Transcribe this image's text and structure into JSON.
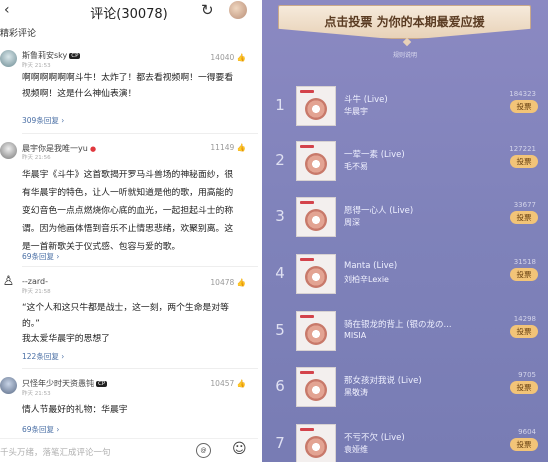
{
  "left": {
    "back_glyph": "‹",
    "title": "评论(30078)",
    "refresh_glyph": "↻",
    "section_title": "精彩评论",
    "comments": [
      {
        "name": "斯鲁莉安sky",
        "badge": "CP",
        "time": "昨天 21:53",
        "likes": "14040",
        "lines": [
          "啊啊啊啊啊啊斗牛！太炸了！都去看视频啊！一得要看",
          "视频啊！这是什么神仙表演！"
        ],
        "replies": "309条回复 ›"
      },
      {
        "name": "晨宇你是我唯一yu",
        "badge": "",
        "time": "昨天 21:56",
        "likes": "11149",
        "lines": [
          "华晨宇《斗牛》这首歌揭开罗马斗兽场的神秘面纱，很",
          "有华晨宇的特色，让人一听就知道是他的歌，用高能的",
          "变幻音色一点点燃烧你心底的血光，一起担起斗士的称",
          "谓。因为他画体悟到音乐不止情思悲绪，欢聚别离。这",
          "是一首新歌关于仪式感、包容与爱的歌。"
        ],
        "replies": "69条回复 ›"
      },
      {
        "name": "--zard-",
        "badge": "",
        "time": "昨天 21:58",
        "likes": "10478",
        "lines": [
          "“这个人和这只牛都是战士，这一刻，两个生命是对等",
          "的。”",
          "我太爱华晨宇的思想了"
        ],
        "replies": "122条回复 ›"
      },
      {
        "name": "只怪年少时天资愚钝",
        "badge": "CP",
        "time": "昨天 21:53",
        "likes": "10457",
        "lines": [
          "情人节最好的礼物：华晨宇"
        ],
        "replies": "69条回复 ›"
      }
    ],
    "input_placeholder": "千头万绪，落笔汇成评论一句",
    "emoji_glyph": "☺",
    "at_label": "@"
  },
  "right": {
    "banner": "点击投票 为你的本期最爱应援",
    "rules": "规则说明",
    "vote_label": "投票",
    "songs": [
      {
        "rank": "1",
        "title": "斗牛 (Live)",
        "artist": "华晨宇",
        "votes": "184323"
      },
      {
        "rank": "2",
        "title": "一荤一素 (Live)",
        "artist": "毛不易",
        "votes": "127221"
      },
      {
        "rank": "3",
        "title": "愿得一心人 (Live)",
        "artist": "周深",
        "votes": "33677"
      },
      {
        "rank": "4",
        "title": "Manta (Live)",
        "artist": "刘柏辛Lexie",
        "votes": "31518"
      },
      {
        "rank": "5",
        "title": "骑在银龙的背上 (银の龙の...",
        "artist": "MISIA",
        "votes": "14298"
      },
      {
        "rank": "6",
        "title": "那女孩对我说 (Live)",
        "artist": "黑敬涛",
        "votes": "9705"
      },
      {
        "rank": "7",
        "title": "不亏不欠 (Live)",
        "artist": "袁娅维",
        "votes": "9604"
      }
    ]
  },
  "colors": {
    "right_bg": "#8b89c2",
    "vote_button": "#f2c478",
    "reply_link": "#4a6fa5"
  }
}
